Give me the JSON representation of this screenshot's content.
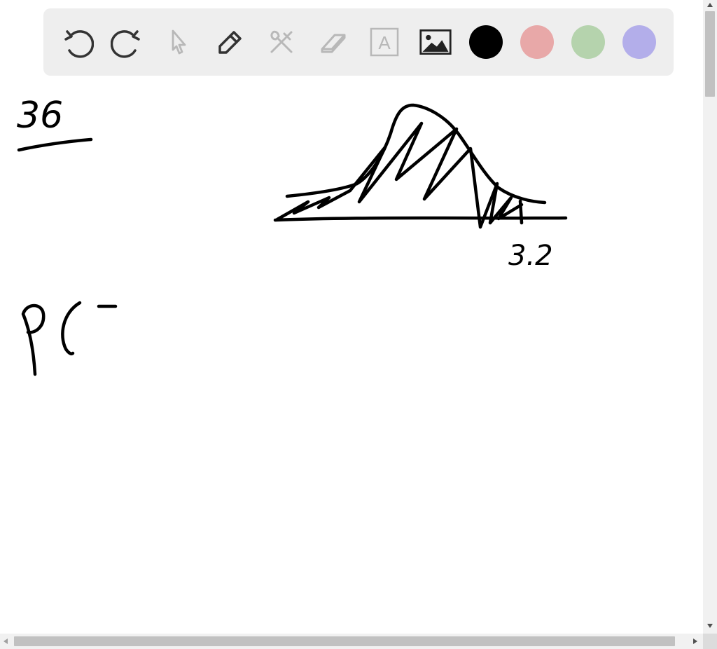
{
  "toolbar": {
    "tools": [
      {
        "icon": "undo-icon",
        "enabled": true
      },
      {
        "icon": "redo-icon",
        "enabled": true
      },
      {
        "icon": "pointer-icon",
        "enabled": false
      },
      {
        "icon": "pen-icon",
        "enabled": true
      },
      {
        "icon": "tools-icon",
        "enabled": false
      },
      {
        "icon": "eraser-icon",
        "enabled": false
      },
      {
        "icon": "text-icon",
        "enabled": false
      },
      {
        "icon": "image-icon",
        "enabled": true
      }
    ],
    "colors": [
      {
        "name": "black",
        "hex": "#000000"
      },
      {
        "name": "red",
        "hex": "#e8a8a8"
      },
      {
        "name": "green",
        "hex": "#b5d3ad"
      },
      {
        "name": "purple",
        "hex": "#b3aeea"
      }
    ],
    "text_icon_glyph": "A"
  },
  "canvas": {
    "handwriting": {
      "problem_number": "36",
      "axis_label": "3.2",
      "probability_start": "P("
    }
  }
}
